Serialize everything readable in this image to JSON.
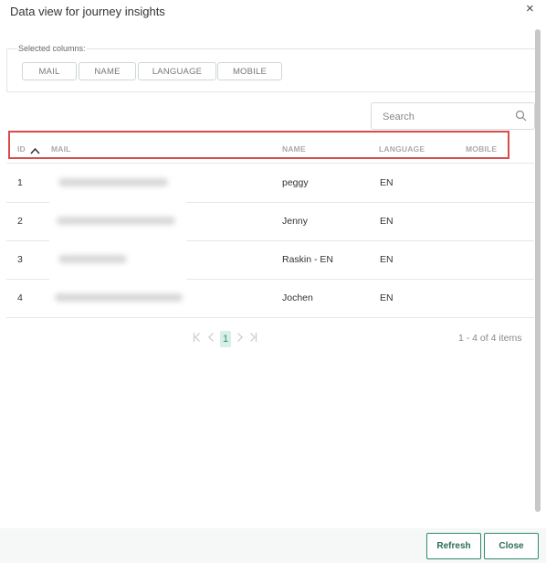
{
  "dialog": {
    "title": "Data view for journey insights",
    "close_icon": "×"
  },
  "selected_columns": {
    "label": "Selected columns:",
    "chips": [
      "MAIL",
      "NAME",
      "LANGUAGE",
      "MOBILE"
    ]
  },
  "search": {
    "placeholder": "Search",
    "value": ""
  },
  "table": {
    "headers": {
      "id": "ID",
      "mail": "MAIL",
      "name": "NAME",
      "language": "LANGUAGE",
      "mobile": "MOBILE"
    },
    "sort": {
      "column": "ID",
      "direction": "ascending"
    },
    "rows": [
      {
        "id": "1",
        "name": "peggy",
        "language": "EN",
        "mobile": ""
      },
      {
        "id": "2",
        "name": "Jenny",
        "language": "EN",
        "mobile": ""
      },
      {
        "id": "3",
        "name": "Raskin - EN",
        "language": "EN",
        "mobile": ""
      },
      {
        "id": "4",
        "name": "Jochen",
        "language": "EN",
        "mobile": ""
      }
    ]
  },
  "pagination": {
    "current_page": "1",
    "summary": "1 - 4 of 4 items"
  },
  "footer": {
    "refresh_label": "Refresh",
    "close_label": "Close"
  },
  "colors": {
    "accent": "#2e8a6d",
    "highlight": "#d94a4a",
    "page_active_bg": "#d7efe7"
  }
}
